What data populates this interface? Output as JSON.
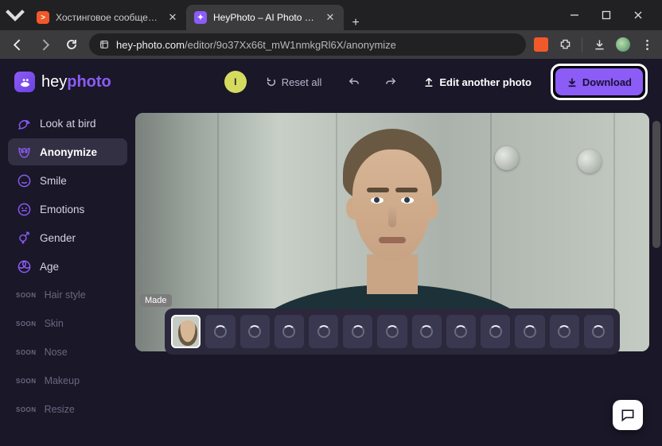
{
  "browser": {
    "tabs": [
      {
        "title": "Хостинговое сообщество «Tim",
        "favicon_bg": "#f1592a",
        "favicon_txt": ">"
      },
      {
        "title": "HeyPhoto – AI Photo Editor On",
        "favicon_bg": "#8b5cf6",
        "favicon_txt": "✦"
      }
    ],
    "url_host": "hey-photo.com",
    "url_path": "/editor/9o37Xx66t_mW1nmkgRl6X/anonymize"
  },
  "header": {
    "logo_plain": "hey",
    "logo_accent": "photo",
    "avatar_initial": "I",
    "reset_label": "Reset all",
    "edit_label": "Edit another photo",
    "download_label": "Download"
  },
  "sidebar": {
    "items": [
      {
        "label": "Look at bird",
        "icon": "bird",
        "state": "normal"
      },
      {
        "label": "Anonymize",
        "icon": "mask",
        "state": "active"
      },
      {
        "label": "Smile",
        "icon": "smile",
        "state": "normal"
      },
      {
        "label": "Emotions",
        "icon": "emo",
        "state": "normal"
      },
      {
        "label": "Gender",
        "icon": "gend",
        "state": "normal"
      },
      {
        "label": "Age",
        "icon": "age",
        "state": "normal"
      },
      {
        "label": "Hair style",
        "soon": true
      },
      {
        "label": "Skin",
        "soon": true
      },
      {
        "label": "Nose",
        "soon": true
      },
      {
        "label": "Makeup",
        "soon": true
      },
      {
        "label": "Resize",
        "soon": true
      }
    ],
    "soon_badge": "SOON"
  },
  "canvas": {
    "made_badge": "Made",
    "thumbnail_count": 12
  }
}
